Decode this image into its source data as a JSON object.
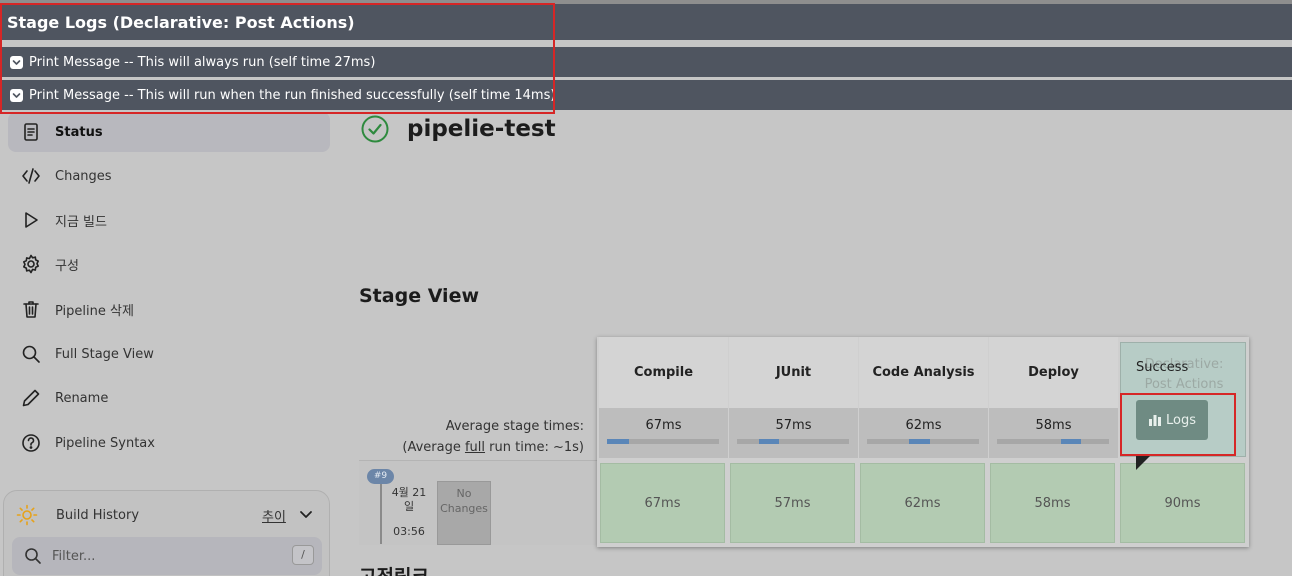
{
  "popup": {
    "title": "Stage Logs (Declarative: Post Actions)",
    "rows": [
      {
        "label": "Print Message -- This will always run (self time 27ms)"
      },
      {
        "label": "Print Message -- This will run when the run finished successfully (self time 14ms)"
      }
    ]
  },
  "sidebar": {
    "items": [
      {
        "label": "Status",
        "icon": "document-icon"
      },
      {
        "label": "Changes",
        "icon": "code-icon"
      },
      {
        "label": "지금 빌드",
        "icon": "play-icon"
      },
      {
        "label": "구성",
        "icon": "gear-icon"
      },
      {
        "label": "Pipeline 삭제",
        "icon": "trash-icon"
      },
      {
        "label": "Full Stage View",
        "icon": "search-icon"
      },
      {
        "label": "Rename",
        "icon": "pencil-icon"
      },
      {
        "label": "Pipeline Syntax",
        "icon": "help-icon"
      }
    ],
    "build_history": {
      "title": "Build History",
      "trend": "추이",
      "filter_placeholder": "Filter...",
      "shortcut": "/"
    }
  },
  "job": {
    "name": "pipelie-test",
    "status_color": "#2e8a3e"
  },
  "stage_view": {
    "title": "Stage View",
    "avg_label": "Average stage times:",
    "avg_full_prefix": "(Average ",
    "avg_full_word": "full",
    "avg_full_suffix": " run time: ~1s)",
    "stages": [
      {
        "name": "Compile",
        "avg": "67ms",
        "cell": "67ms"
      },
      {
        "name": "JUnit",
        "avg": "57ms",
        "cell": "57ms"
      },
      {
        "name": "Code Analysis",
        "avg": "62ms",
        "cell": "62ms"
      },
      {
        "name": "Deploy",
        "avg": "58ms",
        "cell": "58ms"
      }
    ],
    "declarative": {
      "ghost_line1": "Declarative:",
      "ghost_line2": "Post Actions",
      "status": "Success",
      "logs_button": "Logs",
      "cell": "90ms"
    },
    "build": {
      "number": "#9",
      "date_line1": "4월 21",
      "date_line2": "일",
      "time": "03:56",
      "changes_line1": "No",
      "changes_line2": "Changes"
    }
  },
  "bottom_heading": "고정링크",
  "colors": {
    "popup_bg": "#4f5560",
    "highlight_red": "#d62626",
    "success_cell": "#b3cbb2",
    "progress_blue": "#5a86b8"
  }
}
